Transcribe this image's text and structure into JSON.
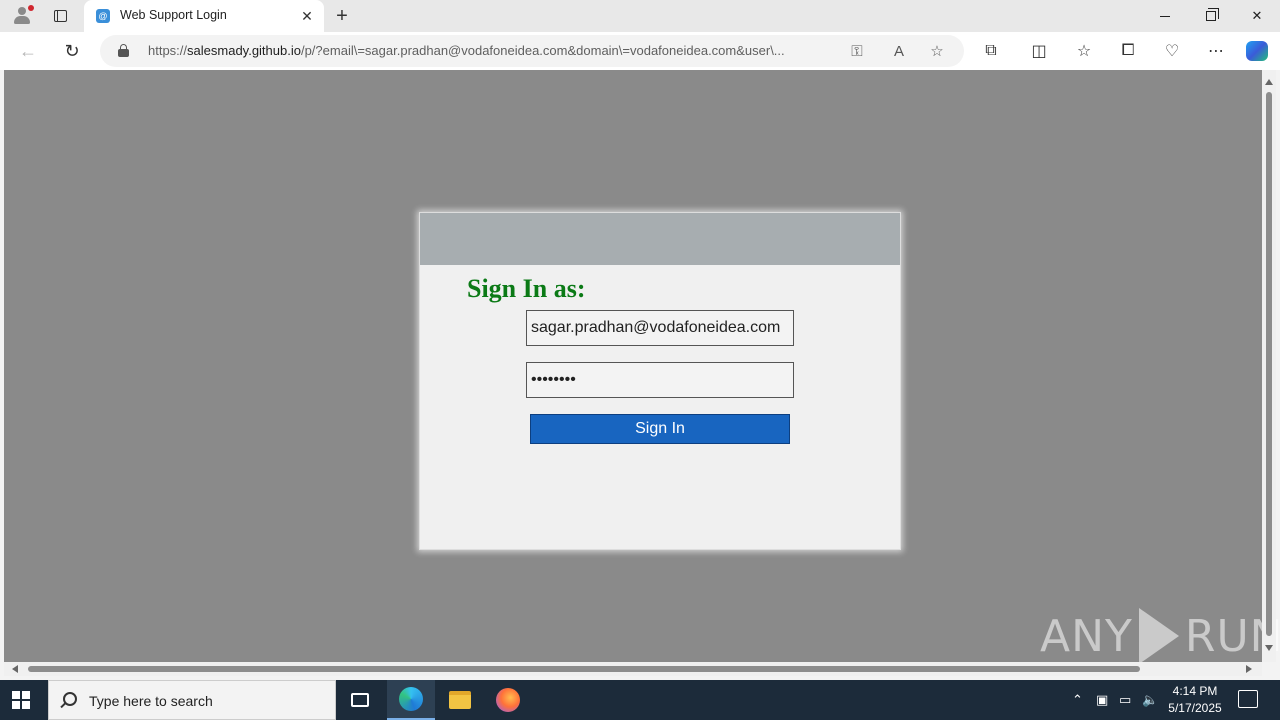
{
  "browser": {
    "tab_title": "Web Support Login",
    "url_prefix": "https://",
    "url_host": "salesmady.github.io",
    "url_rest": "/p/?email\\=sagar.pradhan@vodafoneidea.com&domain\\=vodafoneidea.com&user\\..."
  },
  "login": {
    "heading": "Sign In as:",
    "email_value": "sagar.pradhan@vodafoneidea.com",
    "password_value": "password",
    "button_label": "Sign In"
  },
  "watermark": {
    "left": "ANY",
    "right": "RUN"
  },
  "taskbar": {
    "search_placeholder": "Type here to search",
    "time": "4:14 PM",
    "date": "5/17/2025"
  },
  "colors": {
    "page_background": "#8a8a8a",
    "card_header": "#a7adb0",
    "heading": "#0b7a16",
    "button": "#1865c0"
  }
}
